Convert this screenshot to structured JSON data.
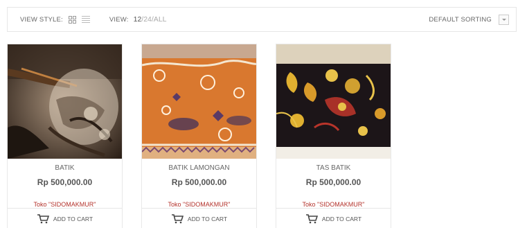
{
  "toolbar": {
    "view_style_label": "VIEW STYLE:",
    "view_label": "VIEW:",
    "view_options": {
      "current": "12",
      "other": "/24/ALL"
    },
    "sort_label": "DEFAULT SORTING"
  },
  "products": [
    {
      "name": "BATIK",
      "price": "Rp 500,000.00",
      "shop": "Toko \"SIDOMAKMUR\"",
      "cart_label": "ADD TO CART"
    },
    {
      "name": "BATIK LAMONGAN",
      "price": "Rp 500,000.00",
      "shop": "Toko \"SIDOMAKMUR\"",
      "cart_label": "ADD TO CART"
    },
    {
      "name": "TAS BATIK",
      "price": "Rp 500,000.00",
      "shop": "Toko \"SIDOMAKMUR\"",
      "cart_label": "ADD TO CART"
    }
  ],
  "colors": {
    "shop_text": "#b3312a",
    "border": "#e6e6e6"
  }
}
